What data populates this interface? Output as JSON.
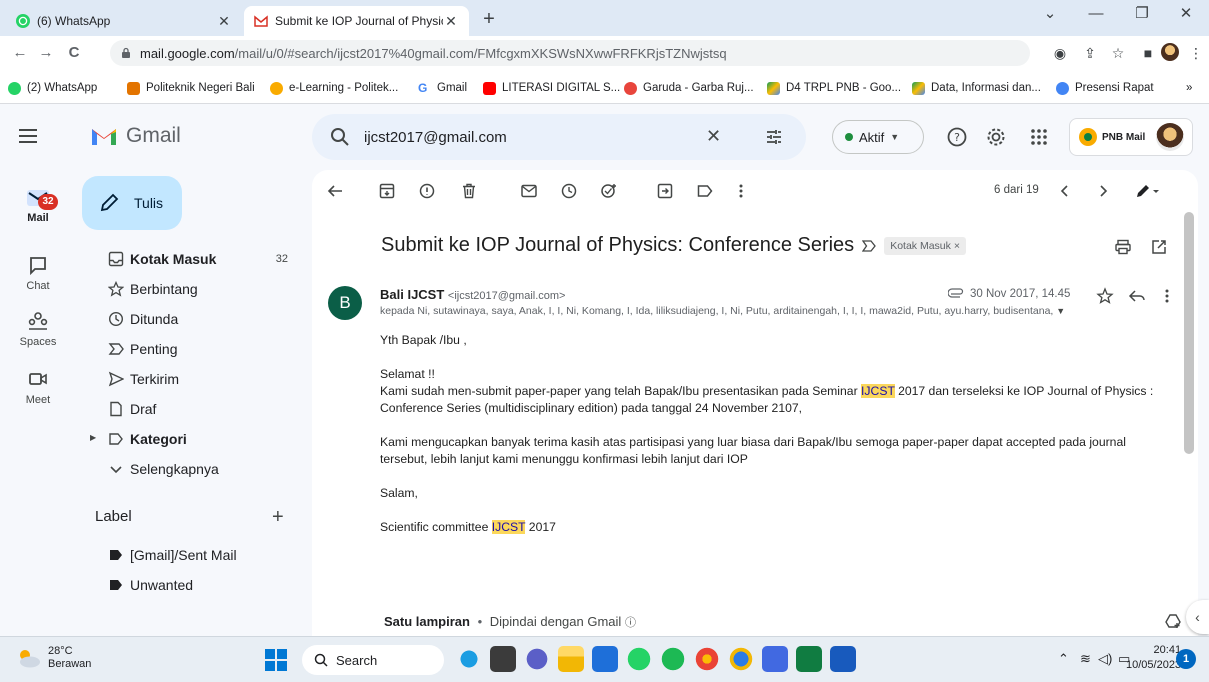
{
  "browser": {
    "tabs": [
      {
        "title": "(6) WhatsApp",
        "active": false
      },
      {
        "title": "Submit ke IOP Journal of Physics",
        "active": true
      }
    ],
    "url_host": "mail.google.com",
    "url_path": "/mail/u/0/#search/ijcst2017%40gmail.com/FMfcgxmXKSWsNXwwFRFKRjsTZNwjstsq",
    "bookmarks": [
      "(2) WhatsApp",
      "Politeknik Negeri Bali",
      "e-Learning - Politek...",
      "Gmail",
      "LITERASI DIGITAL S...",
      "Garuda - Garba Ruj...",
      "D4 TRPL PNB - Goo...",
      "Data, Informasi dan...",
      "Presensi Rapat"
    ],
    "bookmarks_more": "»"
  },
  "gmail": {
    "app_name": "Gmail",
    "search_value": "ijcst2017@gmail.com",
    "status_label": "Aktif",
    "account_label": "PNB Mail"
  },
  "rail": {
    "mail_badge": "32",
    "items": [
      "Mail",
      "Chat",
      "Spaces",
      "Meet"
    ]
  },
  "nav": {
    "compose": "Tulis",
    "items": [
      {
        "label": "Kotak Masuk",
        "count": "32",
        "bold": true
      },
      {
        "label": "Berbintang",
        "count": ""
      },
      {
        "label": "Ditunda",
        "count": ""
      },
      {
        "label": "Penting",
        "count": ""
      },
      {
        "label": "Terkirim",
        "count": ""
      },
      {
        "label": "Draf",
        "count": ""
      },
      {
        "label": "Kategori",
        "count": "",
        "bold": true
      },
      {
        "label": "Selengkapnya",
        "count": ""
      }
    ],
    "label_header": "Label",
    "labels": [
      "[Gmail]/Sent Mail",
      "Unwanted"
    ]
  },
  "message": {
    "pager": "6 dari 19",
    "subject": "Submit ke IOP Journal of Physics: Conference Series",
    "chip": "Kotak Masuk",
    "chip_close": "×",
    "sender_initial": "B",
    "sender_name": "Bali IJCST",
    "sender_email": "<ijcst2017@gmail.com>",
    "date": "30 Nov 2017, 14.45",
    "recipients": "kepada Ni, sutawinaya, saya, Anak, I, I, Ni, Komang, I, Ida, liliksudiajeng, I, Ni, Putu, arditainengah, I, I, I, mawa2id, Putu, ayu.harry, budisentana,",
    "greeting": "Yth Bapak /Ibu ,",
    "selamat": "Selamat !!",
    "para1_a": "Kami sudah men-submit paper-paper yang telah Bapak/Ibu presentasikan pada Seminar",
    "highlight": "IJCST",
    "para1_b": "2017 dan terseleksi ke IOP Journal of Physics : Conference Series  (multidisciplinary edition) pada tanggal 24 November 2107,",
    "para2": "Kami mengucapkan banyak terima kasih atas partisipasi yang luar biasa dari Bapak/Ibu semoga paper-paper dapat accepted pada journal tersebut, lebih lanjut kami menunggu konfirmasi lebih lanjut dari IOP",
    "salam": "Salam,",
    "sig_a": "Scientific committee",
    "sig_b": "2017",
    "attach_count": "Satu lampiran",
    "attach_sep": "•",
    "attach_scan": "Dipindai dengan Gmail"
  },
  "taskbar": {
    "temp": "28°C",
    "weather": "Berawan",
    "search": "Search",
    "time": "20:41",
    "date": "10/05/2023",
    "notif": "1"
  },
  "colors": {
    "accent": "#0b57d0",
    "compose_bg": "#c2e7ff",
    "highlight": "#fbd75b",
    "sender_avatar": "#0b5e47",
    "badge": "#d93025"
  }
}
